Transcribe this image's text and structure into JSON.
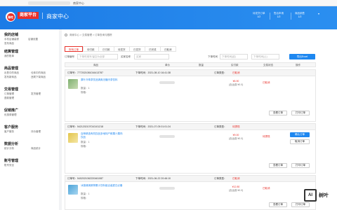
{
  "browser": {
    "title": "商家中心"
  },
  "header": {
    "logo_text": "海吃",
    "platform": "商家平台",
    "center": "商家中心",
    "stats": [
      {
        "label": "待发货订单",
        "value": "1/2"
      },
      {
        "label": "售后申请",
        "value": "1/2"
      },
      {
        "label": "商品销售",
        "value": "1/2"
      }
    ],
    "dropdown": "▾"
  },
  "sidebar": {
    "groups": [
      {
        "title": "我的店铺",
        "items": [
          "手机店铺装修",
          "店铺设置",
          "发布商品",
          "",
          "",
          ""
        ]
      },
      {
        "title": "结算管理",
        "items": [
          "我的账单"
        ]
      },
      {
        "title": "商品管理",
        "items": [
          "出售中的商品",
          "仓库中的商品",
          "发布新商品",
          "违规下架商品"
        ]
      },
      {
        "title": "交易管理",
        "items": [
          "订单管理",
          "发货管理",
          "退款管理",
          ""
        ]
      },
      {
        "title": "促销推广",
        "items": [
          "优惠券管理"
        ]
      },
      {
        "title": "客户服务",
        "items": [
          "客户服务",
          "评价管理"
        ]
      },
      {
        "title": "数据分析",
        "items": [
          "统计分析",
          "商品统计"
        ]
      },
      {
        "title": "账号管理",
        "items": [
          "账号安全"
        ]
      }
    ]
  },
  "breadcrumb": {
    "a": "商家中心",
    "b": "交易管理",
    "c": "订单查询与跟踪"
  },
  "tabs": [
    "所有订单",
    "待付款",
    "已付款",
    "待发货",
    "已发货",
    "已完成",
    "已取消"
  ],
  "filters": {
    "order_no_label": "订单编号",
    "order_no_placeholder": "下单时填写/留空为全部",
    "buyer_label": "买家名称",
    "buyer_placeholder": "买家",
    "time_label": "下单时间",
    "time_start": "下单时间(起)",
    "time_end": "下单时间(止)",
    "export": "导出Excel"
  },
  "table_headers": [
    "商品",
    "单价",
    "数量",
    "实付款",
    "交易状态",
    "操作"
  ],
  "orders": [
    {
      "order_no": "订单号：7772021081016413787",
      "time": "下单时间：2021-08-10 16:41:38",
      "type": "订单类型：",
      "status_label": "已取消",
      "product": "原叶冷萃茶饮品清爽无糖冷茶饮料",
      "qty": "数量：1",
      "spec": "规格：",
      "price": "¥6.90",
      "price_note": "(含运费:¥0.0)",
      "status": "已取消",
      "buttons": [
        "查看订单",
        "打印订单"
      ],
      "thumb_color": "#7fb070"
    },
    {
      "order_no": "订单号：5421202107010101218",
      "time": "下单时间：2021-07-05 01:01:24",
      "type": "订单类型：",
      "status_label": "待提现",
      "product": "百种精选有机饮品多地特产鲜果汁果肉饮品",
      "qty": "数量：1",
      "spec": "规格：",
      "price": "¥9.00",
      "price_note": "(含运费:¥0.0)",
      "status": "待提现",
      "buttons": [
        "查看订单",
        "打印订单",
        "确认订单",
        "取消订单"
      ],
      "thumb_color": "#e3c54a"
    },
    {
      "order_no": "订单号：5402021062220461087",
      "time": "下单时间：2021-06-22 20:46:10",
      "type": "订单类型：",
      "status_label": "已取消",
      "product": "冰镇清爽鲜榨果汁饮料组合装夏日必备",
      "qty": "数量：1",
      "spec": "规格：",
      "price": "¥12.80",
      "price_note": "(含运费:¥0.0)",
      "status": "已取消",
      "buttons": [
        "查看订单",
        "打印订单"
      ],
      "thumb_color": "#4aa3d8"
    }
  ],
  "watermark": {
    "logo": "AI",
    "text": "树叶"
  }
}
